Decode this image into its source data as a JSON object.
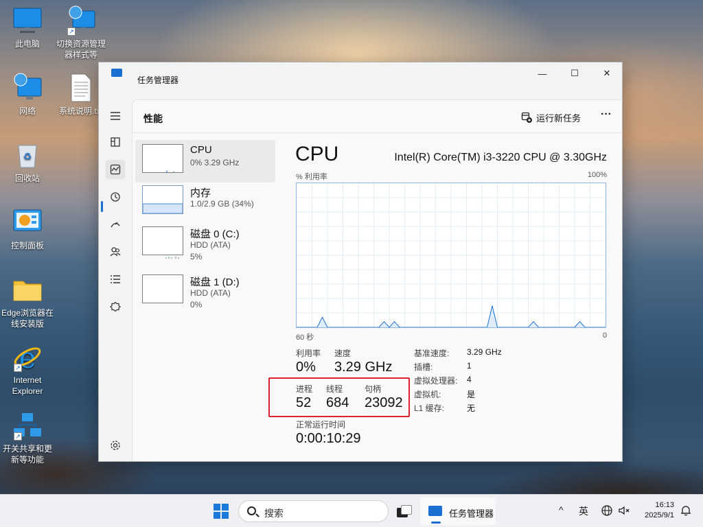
{
  "desktop": {
    "icons": [
      {
        "label": "此电脑"
      },
      {
        "label": "切换资源管理器样式等"
      },
      {
        "label": "网络"
      },
      {
        "label": "系统说明.txt"
      },
      {
        "label": "回收站"
      },
      {
        "label": "控制面板"
      },
      {
        "label": "Edge浏览器在线安装版"
      },
      {
        "label": "Internet Explorer"
      },
      {
        "label": "开关共享和更新等功能"
      }
    ]
  },
  "window": {
    "title": "任务管理器",
    "min_glyph": "—",
    "max_glyph": "☐",
    "close_glyph": "✕"
  },
  "header": {
    "section_title": "性能",
    "run_task_label": "运行新任务",
    "more_glyph": "···"
  },
  "nav": {
    "icons": [
      "hamburger-icon",
      "processes-icon",
      "performance-icon",
      "app-history-icon",
      "startup-apps-icon",
      "users-icon",
      "details-icon",
      "services-icon",
      "settings-icon"
    ]
  },
  "resources": [
    {
      "name": "CPU",
      "line1": "0% 3.29 GHz",
      "line2": ""
    },
    {
      "name": "内存",
      "line1": "1.0/2.9 GB (34%)",
      "line2": ""
    },
    {
      "name": "磁盘 0 (C:)",
      "line1": "HDD (ATA)",
      "line2": "5%"
    },
    {
      "name": "磁盘 1 (D:)",
      "line1": "HDD (ATA)",
      "line2": "0%"
    }
  ],
  "detail": {
    "title": "CPU",
    "model": "Intel(R) Core(TM) i3-3220 CPU @ 3.30GHz",
    "graph_label_left": "% 利用率",
    "graph_label_right": "100%",
    "graph_time_left": "60 秒",
    "graph_time_right": "0",
    "utilization_label": "利用率",
    "utilization_value": "0%",
    "speed_label": "速度",
    "speed_value": "3.29 GHz",
    "processes_label": "进程",
    "processes_value": "52",
    "threads_label": "线程",
    "threads_value": "684",
    "handles_label": "句柄",
    "handles_value": "23092",
    "uptime_label": "正常运行时间",
    "uptime_value": "0:00:10:29",
    "specs": [
      {
        "label": "基准速度:",
        "value": "3.29 GHz"
      },
      {
        "label": "插槽:",
        "value": "1"
      },
      {
        "label": "虚拟处理器:",
        "value": "4"
      },
      {
        "label": "虚拟机:",
        "value": "是"
      },
      {
        "label": "L1 缓存:",
        "value": "无"
      }
    ]
  },
  "chart_data": {
    "type": "area",
    "ylabel": "% 利用率",
    "ylim": [
      0,
      100
    ],
    "xlim": [
      60,
      0
    ],
    "x": [
      60,
      59,
      58,
      57,
      56,
      55,
      54,
      53,
      52,
      51,
      50,
      49,
      48,
      47,
      46,
      45,
      44,
      43,
      42,
      41,
      40,
      39,
      38,
      37,
      36,
      35,
      34,
      33,
      32,
      31,
      30,
      29,
      28,
      27,
      26,
      25,
      24,
      23,
      22,
      21,
      20,
      19,
      18,
      17,
      16,
      15,
      14,
      13,
      12,
      11,
      10,
      9,
      8,
      7,
      6,
      5,
      4,
      3,
      2,
      1,
      0
    ],
    "series": [
      {
        "values": [
          0,
          0,
          0,
          0,
          0,
          7,
          0,
          0,
          0,
          0,
          0,
          0,
          0,
          0,
          0,
          0,
          0,
          4,
          0,
          4,
          0,
          0,
          0,
          0,
          0,
          0,
          0,
          0,
          0,
          0,
          0,
          0,
          0,
          0,
          0,
          0,
          0,
          0,
          15,
          0,
          0,
          0,
          0,
          0,
          0,
          0,
          4,
          0,
          0,
          0,
          0,
          0,
          0,
          0,
          0,
          4,
          0,
          0,
          0,
          0,
          0
        ]
      }
    ]
  },
  "taskbar": {
    "search_placeholder": "搜索",
    "active_app": "任务管理器",
    "tray_chevron": "^",
    "ime": "英",
    "time": "16:13",
    "date": "2025/9/1"
  }
}
